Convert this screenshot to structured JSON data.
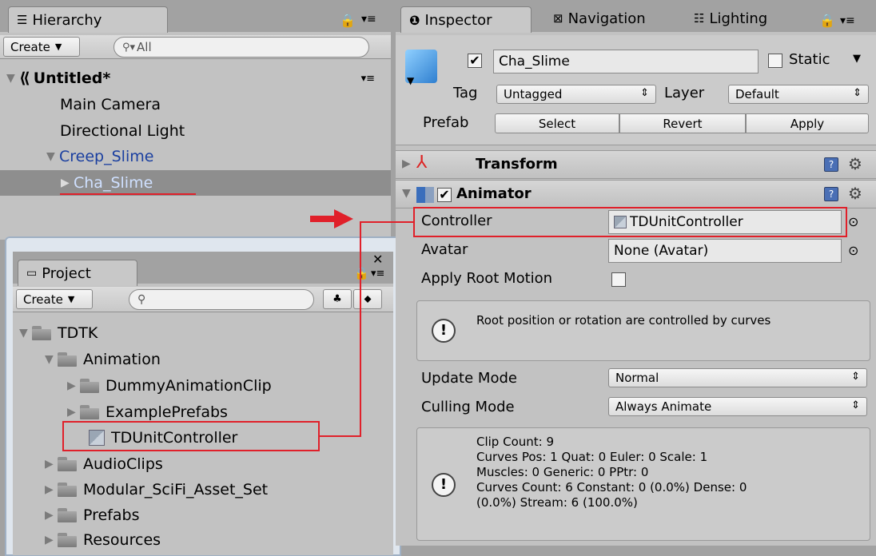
{
  "hierarchy": {
    "tab_label": "Hierarchy",
    "create_label": "Create",
    "search_placeholder": "All",
    "scene_name": "Untitled*",
    "items": [
      "Main Camera",
      "Directional Light",
      "Creep_Slime",
      "Cha_Slime"
    ]
  },
  "inspector": {
    "tabs": [
      "Inspector",
      "Navigation",
      "Lighting"
    ],
    "object_name": "Cha_Slime",
    "static_label": "Static",
    "tag_label": "Tag",
    "tag_value": "Untagged",
    "layer_label": "Layer",
    "layer_value": "Default",
    "prefab_label": "Prefab",
    "prefab_buttons": [
      "Select",
      "Revert",
      "Apply"
    ],
    "transform_label": "Transform",
    "animator_label": "Animator",
    "controller_label": "Controller",
    "controller_value": "TDUnitController",
    "avatar_label": "Avatar",
    "avatar_value": "None (Avatar)",
    "apply_root_motion_label": "Apply Root Motion",
    "root_motion_help": "Root position or rotation are controlled by curves",
    "update_mode_label": "Update Mode",
    "update_mode_value": "Normal",
    "culling_mode_label": "Culling Mode",
    "culling_mode_value": "Always Animate",
    "clip_info": [
      "Clip Count: 9",
      "Curves Pos: 1 Quat: 0 Euler: 0 Scale: 1",
      "Muscles: 0 Generic: 0 PPtr: 0",
      "Curves Count: 6 Constant: 0 (0.0%) Dense: 0",
      "(0.0%) Stream: 6 (100.0%)"
    ]
  },
  "project": {
    "tab_label": "Project",
    "create_label": "Create",
    "tree": [
      "TDTK",
      "Animation",
      "DummyAnimationClip",
      "ExamplePrefabs",
      "TDUnitController",
      "AudioClips",
      "Modular_SciFi_Asset_Set",
      "Prefabs",
      "Resources"
    ]
  },
  "colors": {
    "highlight": "#e0202a",
    "prefab_blue": "#1a3fa0",
    "selection": "#8e8e8e"
  }
}
